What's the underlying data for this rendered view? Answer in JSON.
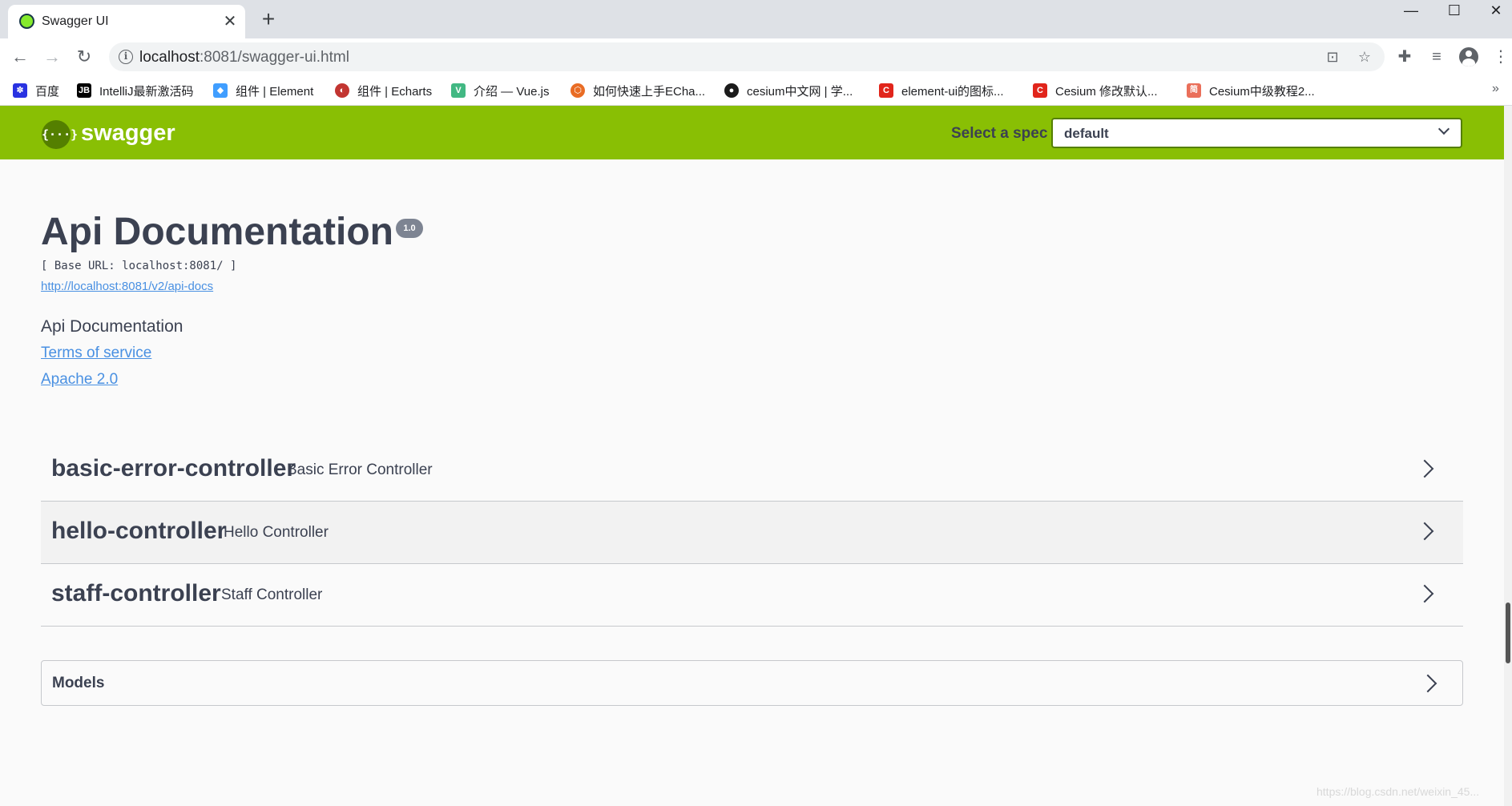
{
  "browser": {
    "tab_title": "Swagger UI",
    "tab_close": "✕",
    "new_tab": "+",
    "url_host": "localhost",
    "url_path": ":8081/swagger-ui.html",
    "window_controls": {
      "minimize": "—",
      "maximize": "☐",
      "close": "✕"
    },
    "bookmarks": [
      {
        "label": "百度",
        "icon": "baidu-paw-icon",
        "color": "#2932e1",
        "glyph": "✽"
      },
      {
        "label": "IntelliJ最新激活码",
        "icon": "jetbrains-icon",
        "color": "#000000",
        "glyph": "JB"
      },
      {
        "label": "组件 | Element",
        "icon": "element-icon",
        "color": "#409eff",
        "glyph": "◆"
      },
      {
        "label": "组件 | Echarts",
        "icon": "echarts-icon",
        "color": "#c23531",
        "glyph": "◐"
      },
      {
        "label": "介绍 — Vue.js",
        "icon": "vue-icon",
        "color": "#42b883",
        "glyph": "V"
      },
      {
        "label": "如何快速上手ECha...",
        "icon": "echarts-tutorial-icon",
        "color": "#e96c24",
        "glyph": "⬡"
      },
      {
        "label": "cesium中文网 | 学...",
        "icon": "cesium-globe-icon",
        "color": "#1b1b1b",
        "glyph": "●"
      },
      {
        "label": "element-ui的图标...",
        "icon": "csdn-icon",
        "color": "#e1251b",
        "glyph": "C"
      },
      {
        "label": "Cesium 修改默认...",
        "icon": "csdn-icon",
        "color": "#e1251b",
        "glyph": "C"
      },
      {
        "label": "Cesium中级教程2...",
        "icon": "jianshu-icon",
        "color": "#ea6f5a",
        "glyph": "简"
      }
    ],
    "more_bookmarks": "»"
  },
  "topbar": {
    "logo_glyph": "{···}",
    "logo_text": "swagger",
    "spec_label": "Select a spec",
    "spec_value": "default",
    "accent_color": "#89bf04"
  },
  "info": {
    "title": "Api Documentation",
    "version": "1.0",
    "base_url": "[ Base URL: localhost:8081/ ]",
    "api_docs_url": "http://localhost:8081/v2/api-docs",
    "description": "Api Documentation",
    "terms_link": "Terms of service",
    "license_link": "Apache 2.0"
  },
  "controllers": [
    {
      "name": "basic-error-controller",
      "description": "Basic Error Controller"
    },
    {
      "name": "hello-controller",
      "description": "Hello Controller"
    },
    {
      "name": "staff-controller",
      "description": "Staff Controller"
    }
  ],
  "models": {
    "title": "Models"
  },
  "watermark": "https://blog.csdn.net/weixin_45..."
}
